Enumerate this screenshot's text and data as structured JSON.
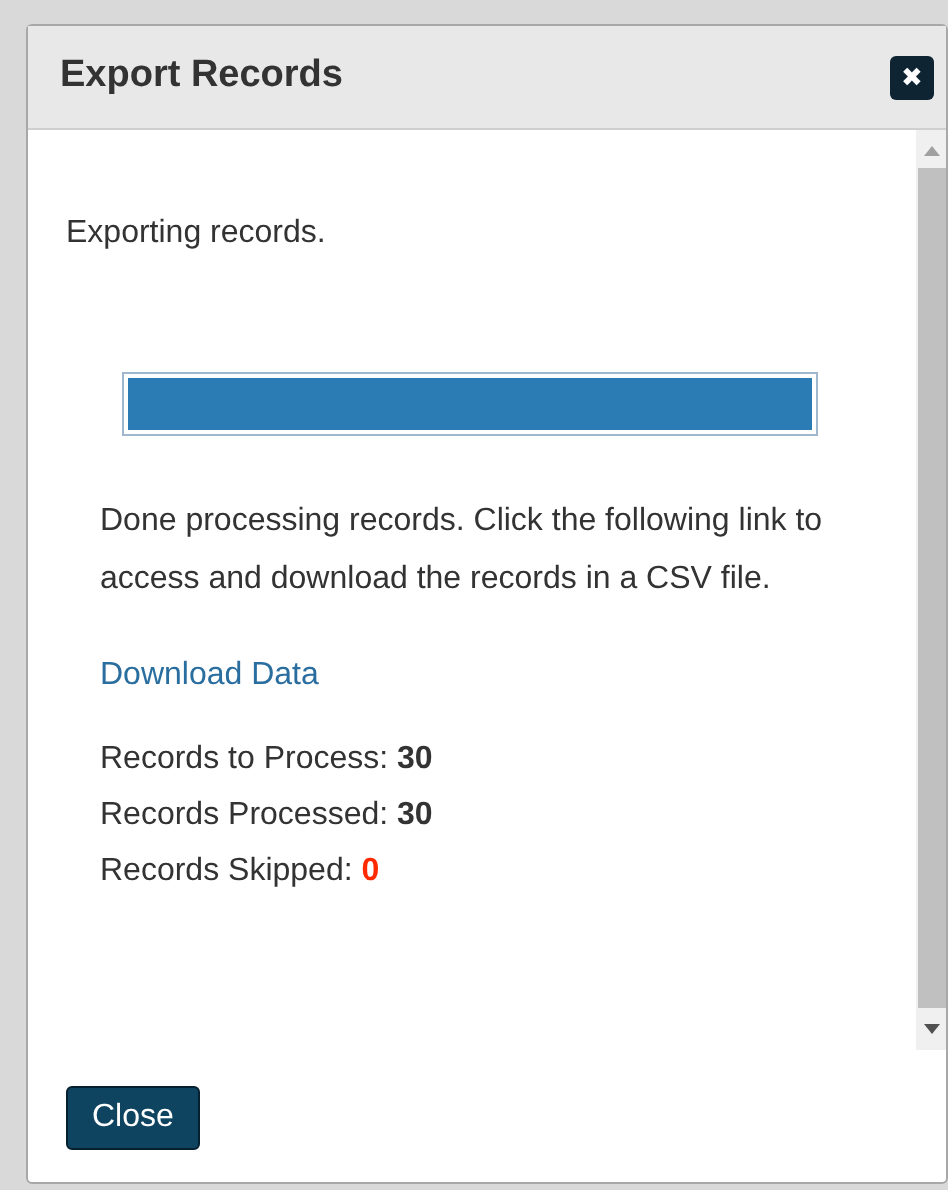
{
  "dialog": {
    "title": "Export Records",
    "close_icon": "✖"
  },
  "content": {
    "status": "Exporting records.",
    "progress": {
      "level": 1
    },
    "message": "Done processing records. Click the following link to access and download the records in a CSV file.",
    "link": "Download Data",
    "stats": [
      {
        "label": "Records to Process:",
        "value": "30",
        "kind": "normal"
      },
      {
        "label": "Records Processed:",
        "value": "30",
        "kind": "normal"
      },
      {
        "label": "Records Skipped:",
        "value": "0",
        "kind": "error"
      }
    ]
  },
  "footer": {
    "button": "Close"
  }
}
